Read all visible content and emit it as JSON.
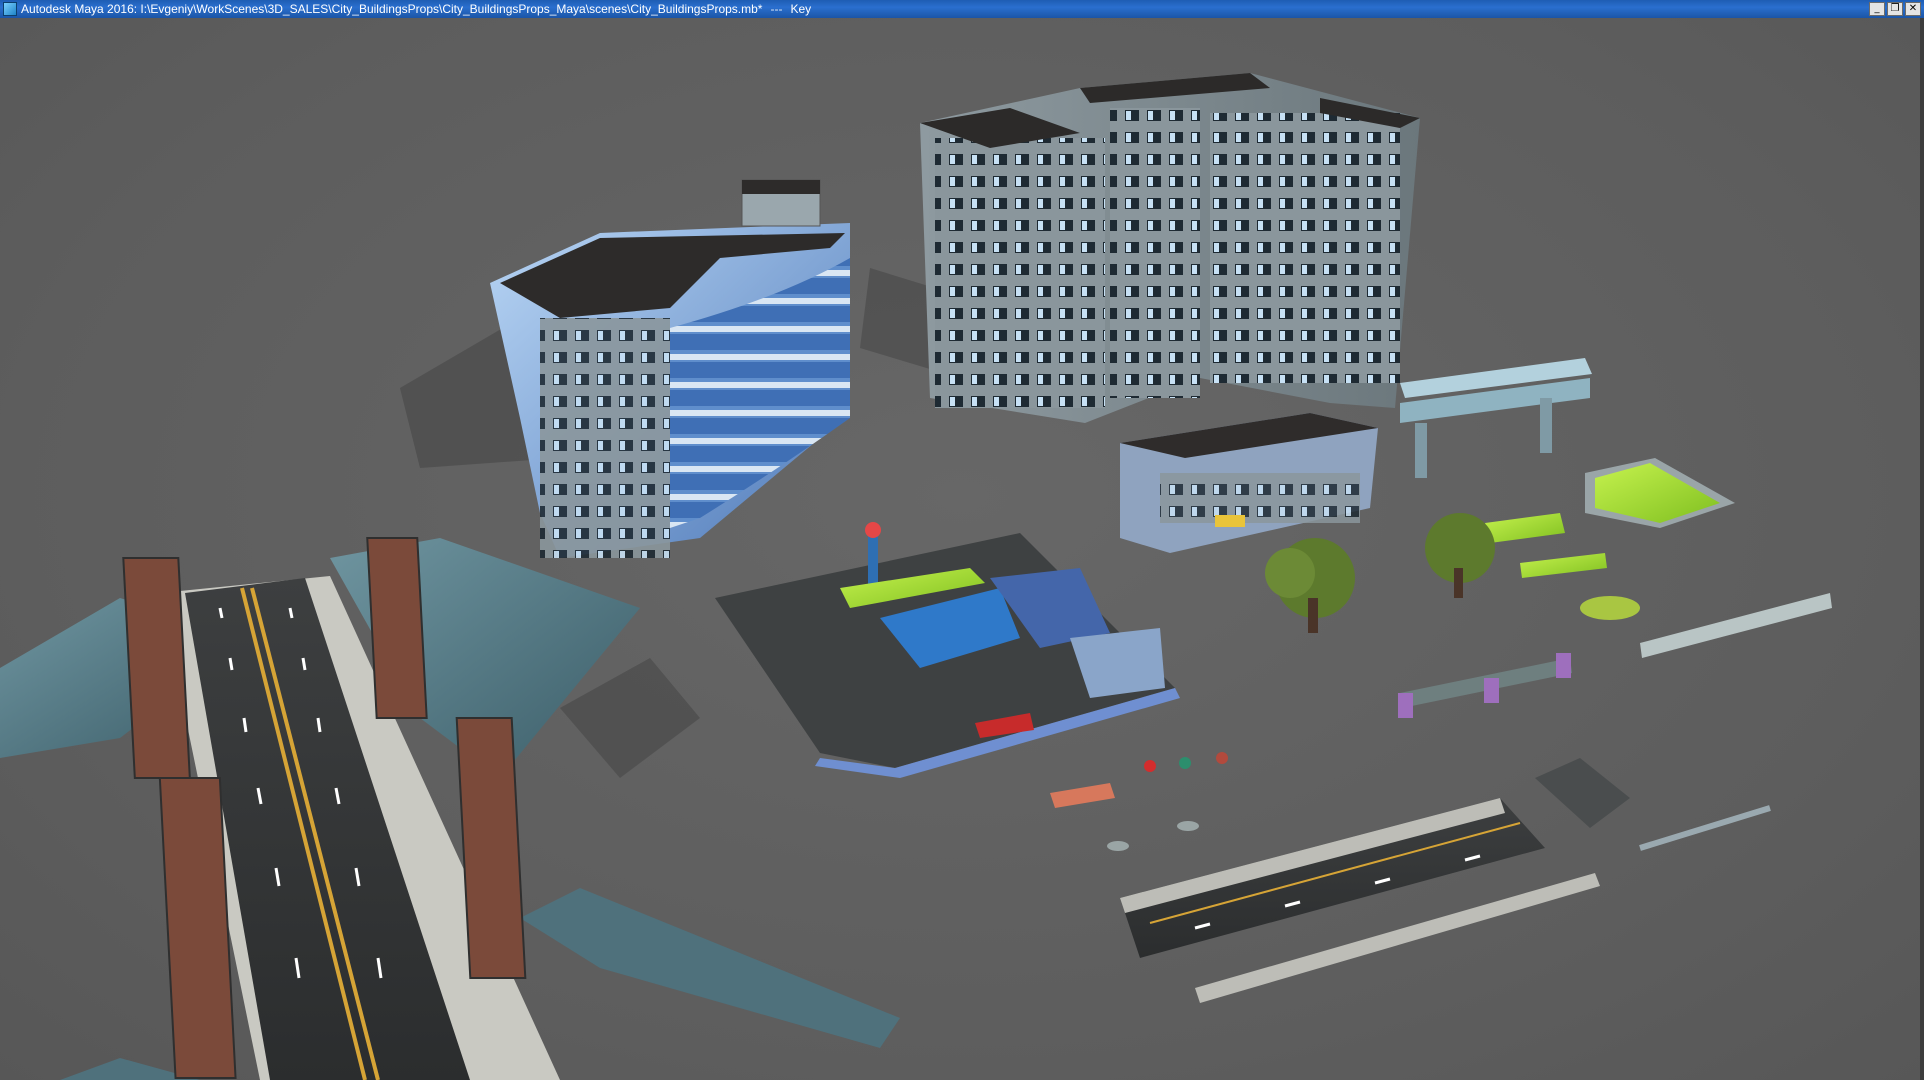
{
  "window": {
    "title": "Autodesk Maya 2016: I:\\Evgeniy\\WorkScenes\\3D_SALES\\City_BuildingsProps\\City_BuildingsProps_Maya\\scenes\\City_BuildingsProps.mb*",
    "separator": "---",
    "mode": "Key",
    "controls": {
      "minimize": "_",
      "restore": "❐",
      "close": "✕"
    }
  },
  "viewport": {
    "background": "#5f5f5f",
    "objects": [
      "office-building-curved",
      "apartment-block-tall",
      "small-shop-building",
      "gas-station",
      "suspension-bridge",
      "pedestrian-overpass",
      "green-ramp",
      "trees",
      "fences",
      "street-props",
      "road-segments",
      "guard-rail"
    ]
  }
}
